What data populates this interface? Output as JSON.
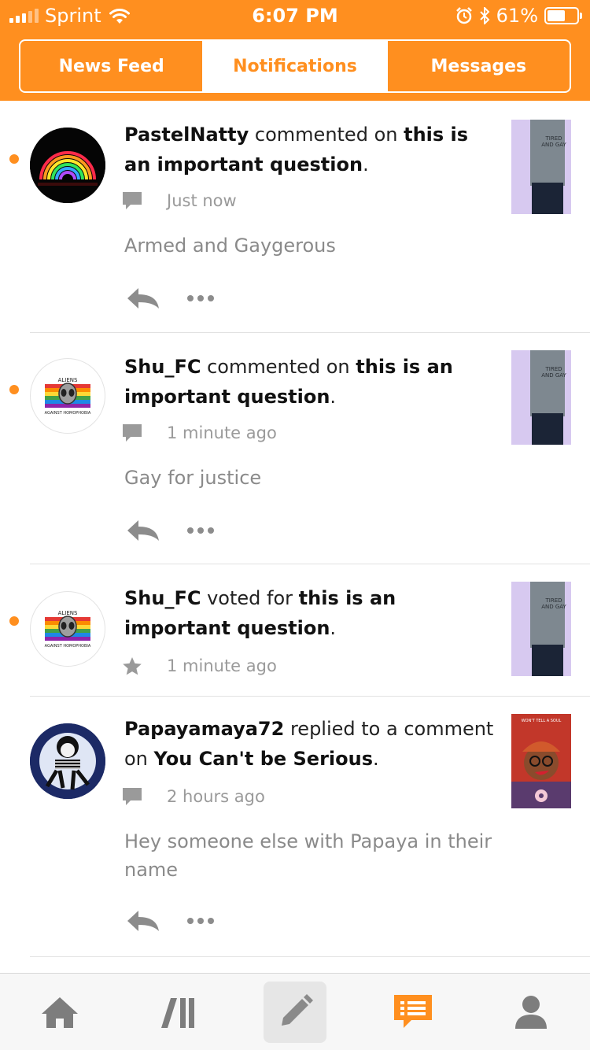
{
  "status_bar": {
    "carrier": "Sprint",
    "time": "6:07 PM",
    "battery": "61%",
    "battery_level": 0.61
  },
  "tabs": [
    {
      "label": "News Feed",
      "active": false
    },
    {
      "label": "Notifications",
      "active": true
    },
    {
      "label": "Messages",
      "active": false
    }
  ],
  "notifications": [
    {
      "unread": true,
      "actor": "PastelNatty",
      "action": " commented on ",
      "target": "this is an important question",
      "end": ".",
      "meta_icon": "comment-icon",
      "time": "Just now",
      "comment": "Armed and Gaygerous"
    },
    {
      "unread": true,
      "actor": "Shu_FC",
      "action": " commented on ",
      "target": "this is an important question",
      "end": ".",
      "meta_icon": "comment-icon",
      "time": "1 minute ago",
      "comment": "Gay for justice"
    },
    {
      "unread": true,
      "actor": "Shu_FC",
      "action": " voted for ",
      "target": "this is an important question",
      "end": ".",
      "meta_icon": "star-icon",
      "time": "1 minute ago"
    },
    {
      "unread": false,
      "actor": "Papayamaya72",
      "action": " replied to a comment on ",
      "target": "You Can't be Serious",
      "end": ".",
      "meta_icon": "comment-icon",
      "time": "2 hours ago",
      "comment": "Hey someone else with Papaya in their name"
    }
  ],
  "thumb_text": {
    "tshirt": "TIRED AND GAY",
    "book": "WON'T TELL A SOUL",
    "badge_top": "ALIENS",
    "badge_bottom": "AGAINST HOMOPHOBIA"
  },
  "bottom_nav": [
    "home-icon",
    "library-icon",
    "compose-icon",
    "notifications-icon",
    "profile-icon"
  ],
  "colors": {
    "accent": "#ff8f1f",
    "muted": "#8a8a8a"
  }
}
